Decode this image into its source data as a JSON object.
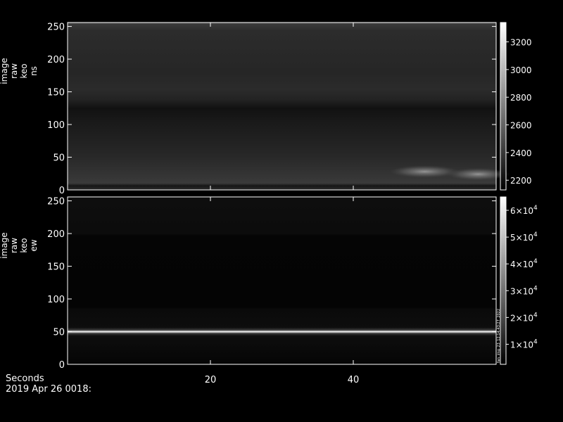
{
  "chart_data": [
    {
      "type": "heatmap",
      "name": "keogram-ns",
      "ylabel_lines": [
        "image",
        "raw",
        "keo",
        "ns"
      ],
      "ylim": [
        0,
        256
      ],
      "yticks": [
        0,
        50,
        100,
        150,
        200,
        250
      ],
      "xlim": [
        0,
        60
      ],
      "colorbar": {
        "range": [
          2130,
          3340
        ],
        "ticks": [
          2200,
          2400,
          2600,
          2800,
          3000,
          3200
        ],
        "tick_labels": [
          "2200",
          "2400",
          "2600",
          "2800",
          "3000",
          "3200"
        ]
      },
      "bright_features": [
        {
          "y": 123,
          "level": "dark-band"
        },
        {
          "y": 28,
          "x_range": [
            47,
            53
          ],
          "level": "bright-blob"
        },
        {
          "y": 24,
          "x_range": [
            55,
            60
          ],
          "level": "bright-blob"
        },
        {
          "y": 5,
          "level": "dark-band"
        },
        {
          "y": 255,
          "level": "bright-edge"
        }
      ]
    },
    {
      "type": "heatmap",
      "name": "keogram-ew",
      "ylabel_lines": [
        "image",
        "raw",
        "keo",
        "ew"
      ],
      "ylim": [
        0,
        256
      ],
      "yticks": [
        0,
        50,
        100,
        150,
        200,
        250
      ],
      "xlim": [
        0,
        60
      ],
      "colorbar": {
        "range": [
          2500,
          65000
        ],
        "ticks": [
          10000,
          20000,
          30000,
          40000,
          50000,
          60000
        ],
        "tick_mantissas": [
          "1",
          "2",
          "3",
          "4",
          "5",
          "6"
        ],
        "tick_exponent": "4"
      },
      "bright_features": [
        {
          "y": 49,
          "level": "bright-line"
        }
      ]
    }
  ],
  "x_axis": {
    "ticks": [
      20,
      40
    ],
    "tick_labels": [
      "20",
      "40"
    ],
    "label": "Seconds",
    "date_label": "2019 Apr 26 0018:"
  },
  "colorbar_side_text": "fan_img_23_12:14:43:27_2022",
  "colors": {
    "background": "#000000",
    "foreground": "#ffffff"
  }
}
